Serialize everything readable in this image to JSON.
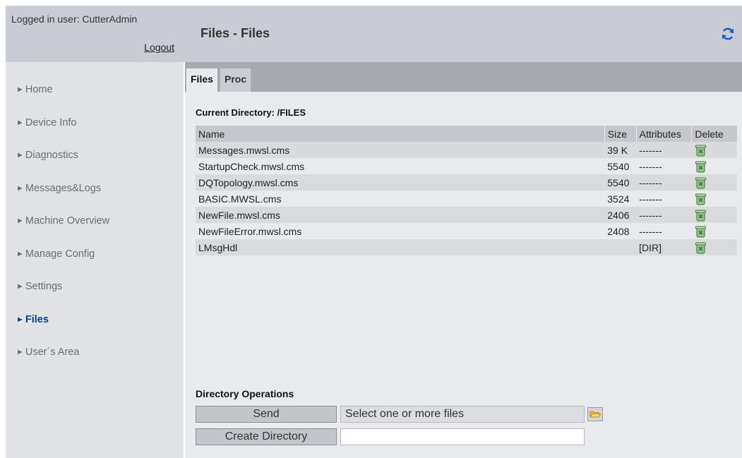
{
  "session": {
    "logged_in_label": "Logged in user: CutterAdmin",
    "logout_label": "Logout"
  },
  "nav": {
    "items": [
      {
        "label": "Home",
        "active": false
      },
      {
        "label": "Device Info",
        "active": false
      },
      {
        "label": "Diagnostics",
        "active": false
      },
      {
        "label": "Messages&Logs",
        "active": false
      },
      {
        "label": "Machine Overview",
        "active": false
      },
      {
        "label": "Manage Config",
        "active": false
      },
      {
        "label": "Settings",
        "active": false
      },
      {
        "label": "Files",
        "active": true
      },
      {
        "label": "User´s Area",
        "active": false
      }
    ]
  },
  "header": {
    "title": "Files - Files",
    "refresh_icon": "refresh-icon"
  },
  "tabs": [
    {
      "label": "Files",
      "active": true
    },
    {
      "label": "Proc",
      "active": false
    }
  ],
  "directory": {
    "current_label": "Current Directory: /FILES",
    "columns": [
      "Name",
      "Size",
      "Attributes",
      "Delete"
    ],
    "rows": [
      {
        "name": "Messages.mwsl.cms",
        "size": "39 K",
        "attributes": "-------"
      },
      {
        "name": "StartupCheck.mwsl.cms",
        "size": "5540",
        "attributes": "-------"
      },
      {
        "name": "DQTopology.mwsl.cms",
        "size": "5540",
        "attributes": "-------"
      },
      {
        "name": "BASIC.MWSL.cms",
        "size": "3524",
        "attributes": "-------"
      },
      {
        "name": "NewFile.mwsl.cms",
        "size": "2406",
        "attributes": "-------"
      },
      {
        "name": "NewFileError.mwsl.cms",
        "size": "2408",
        "attributes": "-------"
      },
      {
        "name": "LMsgHdl",
        "size": "",
        "attributes": "[DIR]"
      }
    ],
    "delete_icon": "trash-icon"
  },
  "operations": {
    "title": "Directory Operations",
    "send_label": "Send",
    "file_select_text": "Select one or more files",
    "create_dir_label": "Create Directory",
    "create_dir_value": "",
    "folder_icon": "folder-open-icon"
  },
  "colors": {
    "header_bg": "#c9ccd4",
    "sidebar_bg": "#e0e2e6",
    "active_nav": "#0d3f8a",
    "refresh_icon": "#1a5fc4"
  }
}
